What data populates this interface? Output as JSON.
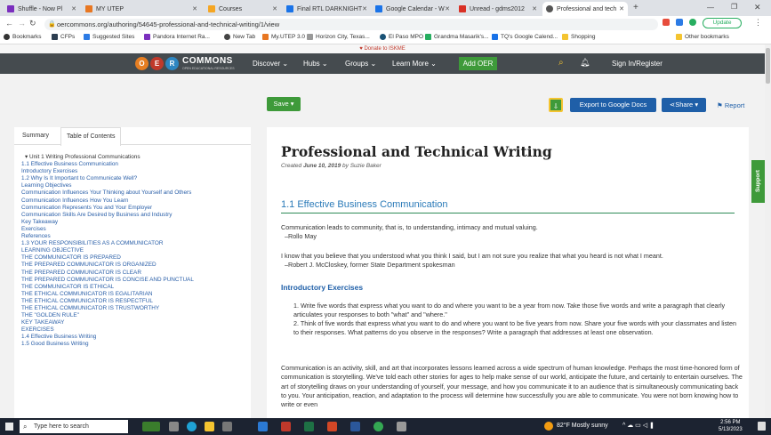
{
  "browser": {
    "tabs": [
      {
        "label": "Shuffle - Now Pl",
        "color": "#7b2fbe"
      },
      {
        "label": "MY UTEP",
        "color": "#e87722"
      },
      {
        "label": "Courses",
        "color": "#f5a623"
      },
      {
        "label": "Final RTL DARKNIGHT",
        "color": "#1a73e8"
      },
      {
        "label": "Google Calendar - W",
        "color": "#1a73e8"
      },
      {
        "label": "Unread - gdms2012",
        "color": "#d93025"
      },
      {
        "label": "Professional and tech",
        "color": "#555555"
      }
    ],
    "url": "oercommons.org/authoring/54645-professional-and-technical-writing/1/view",
    "update_label": "Update"
  },
  "bookmarks": [
    "Bookmarks",
    "CFPs",
    "Suggested Sites",
    "Pandora Internet Ra...",
    "New Tab",
    "My.UTEP 3.0",
    "Horizon City, Texas...",
    "El Paso MPO",
    "Grandma Masarik's...",
    "TQ's Google Calend...",
    "Shopping",
    "Other bookmarks"
  ],
  "site": {
    "donate": "Donate to ISKME",
    "logo_text": "COMMONS",
    "logo_sub": "OPEN EDUCATIONAL RESOURCES",
    "nav": [
      "Discover",
      "Hubs",
      "Groups",
      "Learn More"
    ],
    "add_oer": "Add OER",
    "signin": "Sign In/Register"
  },
  "toolbar": {
    "save": "Save",
    "export": "Export to Google Docs",
    "share": "Share",
    "report": "Report"
  },
  "left_tabs": [
    "Summary",
    "Table of Contents"
  ],
  "toc": [
    "▾ Unit 1 Writing Professional Communications",
    "1.1 Effective Business Communication",
    "Introductory Exercises",
    "1.2 Why Is It Important to Communicate Well?",
    "Learning Objectives",
    "Communication Influences Your Thinking about Yourself and Others",
    "Communication Influences How You Learn",
    "Communication Represents You and Your Employer",
    "Communication Skills Are Desired by Business and Industry",
    "Key Takeaway",
    "Exercises",
    "References",
    "1.3 YOUR RESPONSIBILITIES AS A COMMUNICATOR",
    "LEARNING OBJECTIVE",
    "THE COMMUNICATOR IS PREPARED",
    "THE PREPARED COMMUNICATOR IS ORGANIZED",
    "THE PREPARED COMMUNICATOR IS CLEAR",
    "THE PREPARED COMMUNICATOR IS CONCISE AND PUNCTUAL",
    "THE COMMUNICATOR IS ETHICAL",
    "THE ETHICAL COMMUNICATOR IS EGALITARIAN",
    "THE ETHICAL COMMUNICATOR IS RESPECTFUL",
    "THE ETHICAL COMMUNICATOR IS TRUSTWORTHY",
    "THE \"GOLDEN RULE\"",
    "KEY TAKEAWAY",
    "EXERCISES",
    "1.4 Effective Business Writing",
    "1.5 Good Business Writing"
  ],
  "doc": {
    "title": "Professional and Technical Writing",
    "created_prefix": "Created ",
    "created_date": "June 10, 2019",
    "created_by": " by Suzie Baker",
    "section_title": "1.1 Effective Business Communication",
    "quote1": "Communication leads to community, that is, to understanding, intimacy and mutual valuing.",
    "quote1_author": "–Rollo May",
    "quote2": "I know that you believe that you understood what you think I said, but I am not sure you realize that what you heard is not what I meant.",
    "quote2_author": "–Robert J. McCloskey, former State Department spokesman",
    "subhead": "Introductory Exercises",
    "ex1": "1. Write five words that express what you want to do and where you want to be a year from now. Take those five words and write a paragraph that clearly articulates your responses to both \"what\" and \"where.\"",
    "ex2": "2. Think of five words that express what you want to do and where you want to be five years from now. Share your five words with your classmates and listen to their responses. What patterns do you observe in the responses? Write a paragraph that addresses at least one observation.",
    "para": "Communication is an activity, skill, and art that incorporates lessons learned across a wide spectrum of human knowledge. Perhaps the most time-honored form of communication is storytelling. We've told each other stories for ages to help make sense of our world, anticipate the future, and certainly to entertain ourselves. The art of storytelling draws on your understanding of yourself, your message, and how you communicate it to an audience that is simultaneously communicating back to you. Your anticipation, reaction, and adaptation to the process will determine how successfully you are able to communicate. You were not born knowing how to write or even"
  },
  "support": "Support",
  "taskbar": {
    "search": "Type here to search",
    "weather": "82°F Mostly sunny",
    "time": "2:56 PM",
    "date": "5/13/2023"
  }
}
